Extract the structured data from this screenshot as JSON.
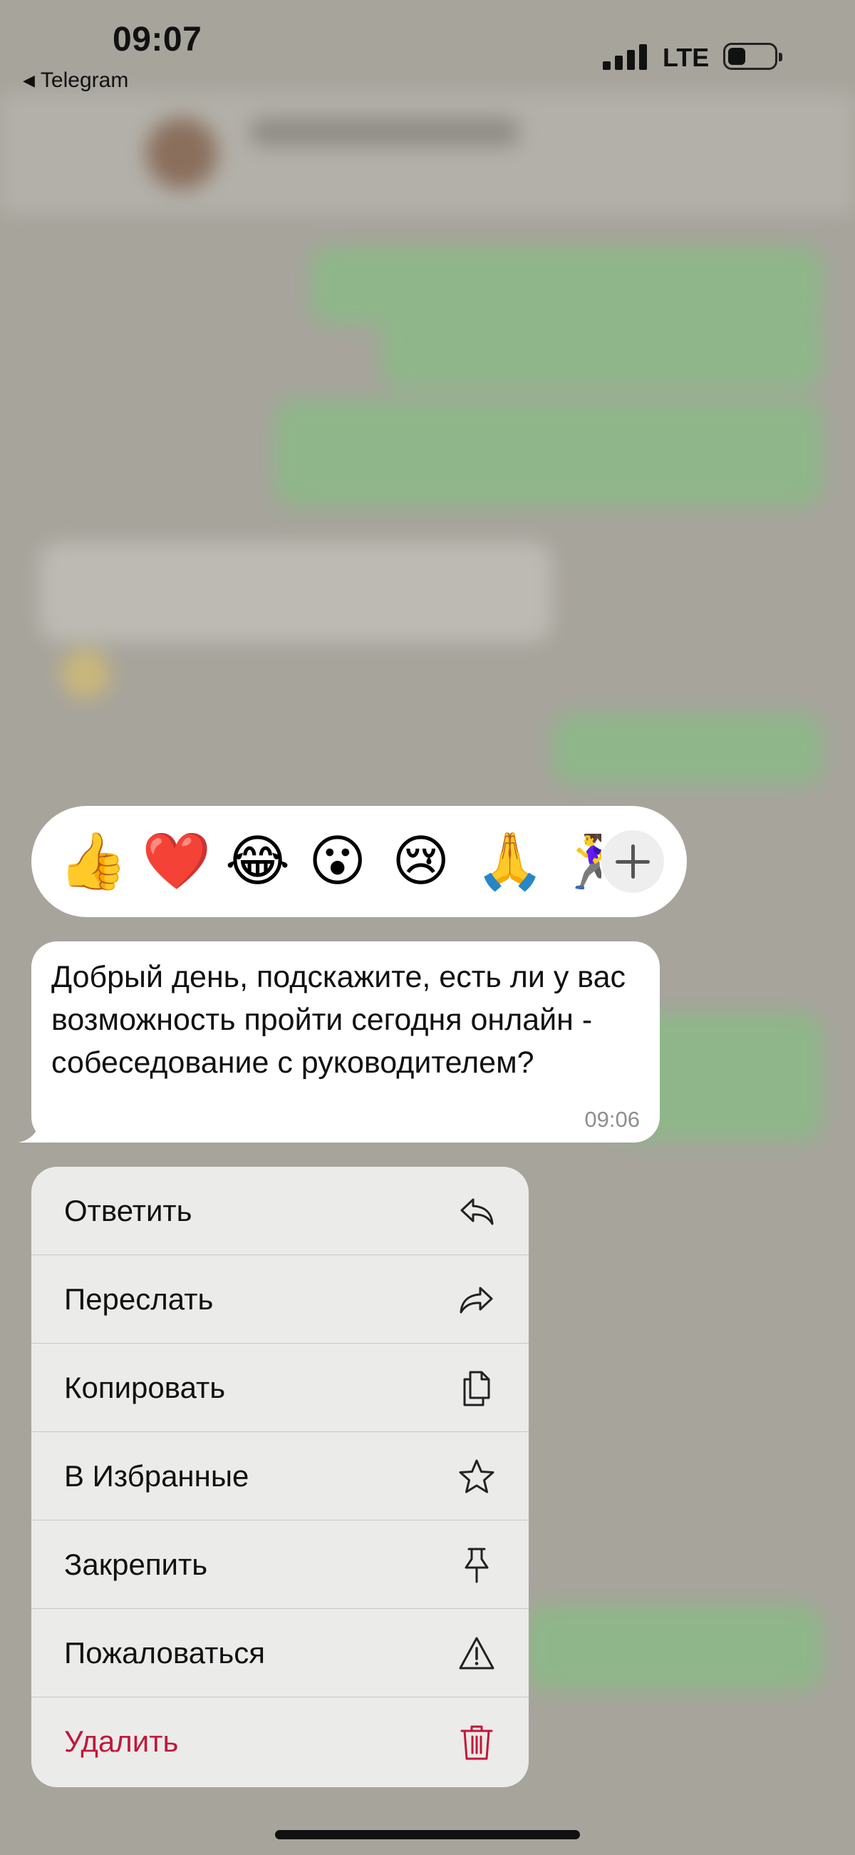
{
  "status_bar": {
    "time": "09:07",
    "back_app": "Telegram",
    "back_arrow": "◀",
    "network": "LTE"
  },
  "reactions": [
    {
      "emoji": "👍",
      "name": "thumbs-up"
    },
    {
      "emoji": "❤️",
      "name": "heart"
    },
    {
      "emoji": "😂",
      "name": "laughing"
    },
    {
      "emoji": "😮",
      "name": "surprised"
    },
    {
      "emoji": "😢",
      "name": "crying"
    },
    {
      "emoji": "🙏",
      "name": "folded-hands"
    },
    {
      "emoji": "🏃‍♀️",
      "name": "running-woman"
    }
  ],
  "message": {
    "text": "Добрый день, подскажите, есть ли у вас возможность пройти сегодня онлайн - собеседование с руководителем?",
    "time": "09:06"
  },
  "menu": {
    "items": [
      {
        "label": "Ответить",
        "icon": "reply-icon"
      },
      {
        "label": "Переслать",
        "icon": "forward-icon"
      },
      {
        "label": "Копировать",
        "icon": "copy-icon"
      },
      {
        "label": "В Избранные",
        "icon": "star-icon"
      },
      {
        "label": "Закрепить",
        "icon": "pin-icon"
      },
      {
        "label": "Пожаловаться",
        "icon": "warning-icon"
      },
      {
        "label": "Удалить",
        "icon": "trash-icon",
        "color": "#c0183a"
      }
    ]
  },
  "colors": {
    "danger": "#c0183a",
    "outgoing_bubble": "#8fb68a",
    "menu_background": "#ebebea"
  }
}
